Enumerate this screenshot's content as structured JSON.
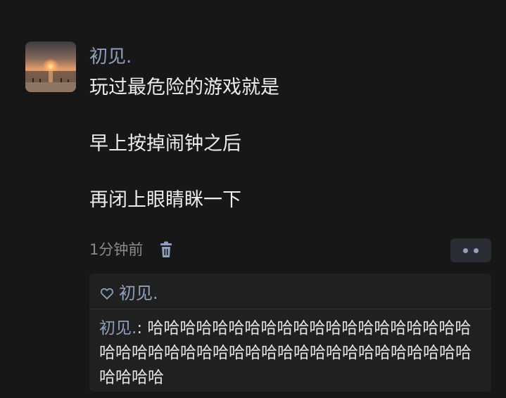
{
  "post": {
    "author": "初见.",
    "avatar_icon": "sunset-beach-photo",
    "lines": [
      "玩过最危险的游戏就是",
      "",
      "早上按掉闹钟之后",
      "",
      "再闭上眼睛眯一下"
    ],
    "timestamp": "1分钟前",
    "delete_icon": "trash-icon",
    "more_icon": "more-dots-icon"
  },
  "likes": {
    "icon": "heart-icon",
    "names": "初见."
  },
  "comments": [
    {
      "author": "初见.",
      "separator": ": ",
      "text": "哈哈哈哈哈哈哈哈哈哈哈哈哈哈哈哈哈哈哈哈哈哈哈哈哈哈哈哈哈哈哈哈哈哈哈哈哈哈哈哈哈哈哈哈哈哈哈"
    }
  ],
  "colors": {
    "background": "#171717",
    "link_blue": "#8f9fbe",
    "panel": "#202020",
    "timestamp_gray": "#8a8a8a"
  }
}
